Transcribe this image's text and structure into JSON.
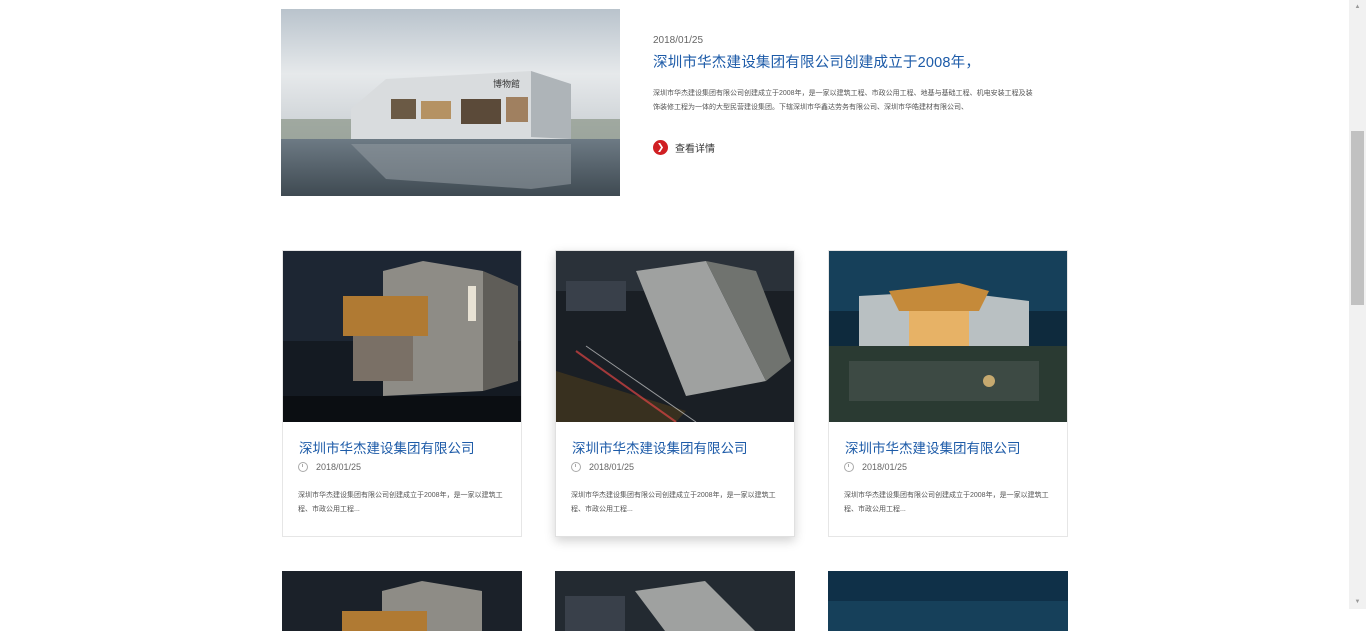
{
  "featured": {
    "date": "2018/01/25",
    "title": "深圳市华杰建设集团有限公司创建成立于2008年，",
    "description": "深圳市华杰建设集团有限公司创建成立于2008年，是一家以建筑工程、市政公用工程、地基与基础工程、机电安装工程及装饰装修工程为一体的大型民营建设集团。下辖深圳市华鑫达劳务有限公司、深圳市华皓建材有限公司、",
    "more_label": "查看详情",
    "image_sign": "博物館"
  },
  "cards": [
    {
      "title": "深圳市华杰建设集团有限公司",
      "date": "2018/01/25",
      "description": "深圳市华杰建设集团有限公司创建成立于2008年，是一家以建筑工程、市政公用工程..."
    },
    {
      "title": "深圳市华杰建设集团有限公司",
      "date": "2018/01/25",
      "description": "深圳市华杰建设集团有限公司创建成立于2008年，是一家以建筑工程、市政公用工程..."
    },
    {
      "title": "深圳市华杰建设集团有限公司",
      "date": "2018/01/25",
      "description": "深圳市华杰建设集团有限公司创建成立于2008年，是一家以建筑工程、市政公用工程..."
    }
  ],
  "colors": {
    "title_blue": "#1d5ba8",
    "accent_red": "#d01f23"
  },
  "icons": {
    "more": "arrow-right-circle-icon",
    "date": "clock-icon"
  }
}
